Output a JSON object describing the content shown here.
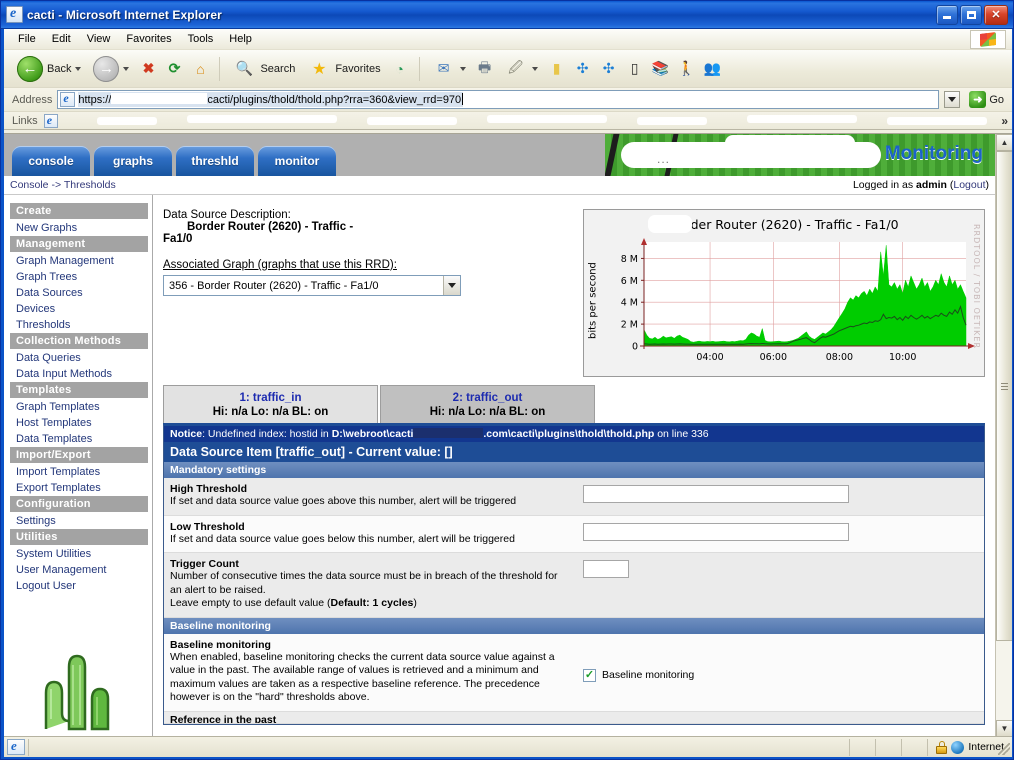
{
  "window": {
    "title": "cacti - Microsoft Internet Explorer",
    "icon": "ie-document-icon",
    "minimize": "Minimize",
    "maximize": "Restore",
    "close": "Close"
  },
  "menubar": {
    "items": [
      {
        "label": "File"
      },
      {
        "label": "Edit"
      },
      {
        "label": "View"
      },
      {
        "label": "Favorites"
      },
      {
        "label": "Tools"
      },
      {
        "label": "Help"
      }
    ],
    "logo": "windows-flag-icon"
  },
  "toolbar": {
    "back": "Back",
    "search": "Search",
    "favorites": "Favorites",
    "icons": [
      "back-icon",
      "back-dropdown-icon",
      "forward-icon",
      "forward-dropdown-icon",
      "stop-icon",
      "refresh-icon",
      "home-icon",
      "search-icon",
      "favorites-icon",
      "history-icon",
      "mail-icon",
      "mail-dropdown-icon",
      "print-icon",
      "edit-icon",
      "edit-dropdown-icon",
      "notes-icon",
      "messenger-sync-icon",
      "messenger-sync2-icon",
      "pda-icon",
      "research-icon",
      "person-icon",
      "messenger-icon"
    ]
  },
  "address": {
    "label": "Address",
    "url_prefix": "https://",
    "url_suffix": "cacti/plugins/thold/thold.php?rra=360&view_rrd=970",
    "go": "Go"
  },
  "links": {
    "label": "Links",
    "overflow": "»"
  },
  "cacti": {
    "tabs": [
      {
        "label": "console",
        "name": "tab-console"
      },
      {
        "label": "graphs",
        "name": "tab-graphs"
      },
      {
        "label": "threshld",
        "name": "tab-threshld"
      },
      {
        "label": "monitor",
        "name": "tab-monitor"
      }
    ],
    "banner_title": "Monitoring",
    "breadcrumb_console": "Console",
    "breadcrumb_sep": " -> ",
    "breadcrumb_page": "Thresholds",
    "logged_in_prefix": "Logged in as ",
    "logged_in_user": "admin",
    "logout_open": " (",
    "logout": "Logout",
    "logout_close": ")"
  },
  "sidebar": {
    "groups": [
      {
        "header": "Create",
        "items": [
          {
            "label": "New Graphs",
            "name": "sidebar-item-new-graphs"
          }
        ]
      },
      {
        "header": "Management",
        "items": [
          {
            "label": "Graph Management",
            "name": "sidebar-item-graph-management"
          },
          {
            "label": "Graph Trees",
            "name": "sidebar-item-graph-trees"
          },
          {
            "label": "Data Sources",
            "name": "sidebar-item-data-sources"
          },
          {
            "label": "Devices",
            "name": "sidebar-item-devices"
          },
          {
            "label": "Thresholds",
            "name": "sidebar-item-thresholds"
          }
        ]
      },
      {
        "header": "Collection Methods",
        "items": [
          {
            "label": "Data Queries",
            "name": "sidebar-item-data-queries"
          },
          {
            "label": "Data Input Methods",
            "name": "sidebar-item-data-input-methods"
          }
        ]
      },
      {
        "header": "Templates",
        "items": [
          {
            "label": "Graph Templates",
            "name": "sidebar-item-graph-templates"
          },
          {
            "label": "Host Templates",
            "name": "sidebar-item-host-templates"
          },
          {
            "label": "Data Templates",
            "name": "sidebar-item-data-templates"
          }
        ]
      },
      {
        "header": "Import/Export",
        "items": [
          {
            "label": "Import Templates",
            "name": "sidebar-item-import-templates"
          },
          {
            "label": "Export Templates",
            "name": "sidebar-item-export-templates"
          }
        ]
      },
      {
        "header": "Configuration",
        "items": [
          {
            "label": "Settings",
            "name": "sidebar-item-settings"
          }
        ]
      },
      {
        "header": "Utilities",
        "items": [
          {
            "label": "System Utilities",
            "name": "sidebar-item-system-utilities"
          },
          {
            "label": "User Management",
            "name": "sidebar-item-user-management"
          },
          {
            "label": "Logout User",
            "name": "sidebar-item-logout-user"
          }
        ]
      }
    ],
    "logo": "cactus-logo"
  },
  "main": {
    "desc_label": "Data Source Description:",
    "desc_line1": "Border Router (2620) - Traffic -",
    "desc_line2": "Fa1/0",
    "assoc_label": "Associated Graph (graphs that use this RRD):",
    "assoc_selected": "356 -       Border Router (2620) - Traffic - Fa1/0",
    "ds_tabs": [
      {
        "title": "1: traffic_in",
        "sub": "Hi: n/a Lo: n/a BL: on",
        "active": false
      },
      {
        "title": "2: traffic_out",
        "sub": "Hi: n/a Lo: n/a BL: on",
        "active": true
      }
    ],
    "notice_prefix": "Notice",
    "notice_colon": ": Undefined index: hostid in ",
    "notice_path1": "D:\\webroot\\cacti",
    "notice_path2": ".com\\cacti\\plugins\\thold\\thold.php",
    "notice_line": " on line 336",
    "ds_item_bar": "Data Source Item [traffic_out] - Current value: []",
    "section_mandatory": "Mandatory settings",
    "section_baseline": "Baseline monitoring",
    "rows": [
      {
        "title": "High Threshold",
        "desc": "If set and data source value goes above this number, alert will be triggered",
        "value": "",
        "field": "high-threshold-input"
      },
      {
        "title": "Low Threshold",
        "desc": "If set and data source value goes below this number, alert will be triggered",
        "value": "",
        "field": "low-threshold-input"
      },
      {
        "title": "Trigger Count",
        "desc_a": "Number of consecutive times the data source must be in breach of the threshold for an alert to be raised.",
        "desc_b": "Leave empty to use default value (",
        "desc_bold": "Default: 1 cycles",
        "desc_c": ")",
        "value": "",
        "field": "trigger-count-input"
      }
    ],
    "baseline": {
      "title": "Baseline monitoring",
      "desc": "When enabled, baseline monitoring checks the current data source value against a value in the past. The available range of values is retrieved and a minimum and maximum values are taken as a respective baseline reference. The precedence however is on the \"hard\" thresholds above.",
      "checkbox_label": "Baseline monitoring",
      "checked": true,
      "check_mark": "✓"
    },
    "cutoff_row": "Reference in the past"
  },
  "chart_data": {
    "type": "area",
    "title": "Border Router (2620) - Traffic - Fa1/0",
    "ylabel": "bits per second",
    "xlabel": "",
    "watermark": "RRDTOOL / TOBI OETIKER",
    "ylim": [
      0,
      9500000
    ],
    "ytick_labels": [
      "0",
      "2 M",
      "4 M",
      "6 M",
      "8 M"
    ],
    "ytick_values": [
      0,
      2000000,
      4000000,
      6000000,
      8000000
    ],
    "xtick_labels": [
      "04:00",
      "06:00",
      "08:00",
      "10:00"
    ],
    "grid": true,
    "legend_position": "none",
    "series": [
      {
        "name": "traffic_in",
        "type": "area",
        "color": "#00cc00",
        "values": [
          1500000,
          1000000,
          700000,
          650000,
          800000,
          600000,
          700000,
          900000,
          750000,
          800000,
          850000,
          700000,
          900000,
          1000000,
          800000,
          700000,
          600000,
          400000,
          350000,
          400000,
          450000,
          400000,
          380000,
          420000,
          400000,
          430000,
          380000,
          400000,
          420000,
          450000,
          400000,
          380000,
          420000,
          400000,
          450000,
          500000,
          480000,
          600000,
          1000000,
          1200000,
          1100000,
          900000,
          800000,
          1600000,
          500000,
          400000,
          380000,
          400000,
          420000,
          450000,
          400000,
          380000,
          400000,
          450000,
          500000,
          600000,
          700000,
          900000,
          1100000,
          1300000,
          900000,
          700000,
          600000,
          800000,
          1000000,
          1200000,
          1100000,
          1300000,
          1500000,
          1800000,
          2200000,
          2600000,
          3000000,
          3400000,
          4000000,
          4400000,
          4200000,
          4600000,
          4400000,
          4800000,
          5000000,
          4600000,
          5200000,
          4800000,
          5400000,
          5000000,
          8600000,
          6400000,
          9200000,
          5600000,
          5400000,
          5800000,
          5200000,
          5600000,
          4800000,
          6000000,
          5400000,
          6400000,
          5800000,
          5200000,
          5600000,
          6200000,
          5400000,
          5800000,
          5000000,
          5400000,
          6000000,
          5600000,
          6600000,
          5800000,
          5400000,
          6400000,
          5600000,
          6000000,
          5200000,
          5600000,
          5000000,
          4400000
        ]
      },
      {
        "name": "traffic_out",
        "type": "line",
        "color": "#1a4d1a",
        "values": [
          200000,
          180000,
          160000,
          170000,
          180000,
          160000,
          170000,
          180000,
          175000,
          180000,
          185000,
          170000,
          180000,
          190000,
          180000,
          175000,
          170000,
          160000,
          155000,
          160000,
          165000,
          160000,
          158000,
          162000,
          160000,
          163000,
          158000,
          160000,
          162000,
          165000,
          160000,
          158000,
          162000,
          160000,
          165000,
          170000,
          168000,
          180000,
          200000,
          220000,
          210000,
          200000,
          195000,
          230000,
          200000,
          190000,
          185000,
          190000,
          195000,
          200000,
          195000,
          190000,
          200000,
          300000,
          420000,
          500000,
          560000,
          620000,
          700000,
          760000,
          600000,
          400000,
          300000,
          500000,
          700000,
          850000,
          800000,
          900000,
          1000000,
          1100000,
          1250000,
          1400000,
          1500000,
          1600000,
          1700000,
          1800000,
          1750000,
          1850000,
          1900000,
          2000000,
          2100000,
          2050000,
          2200000,
          2150000,
          2300000,
          2250000,
          2400000,
          2900000,
          2500000,
          2600000,
          2550000,
          2700000,
          2400000,
          2600000,
          2350000,
          2700000,
          2500000,
          2800000,
          2600000,
          2450000,
          2600000,
          2800000,
          2550000,
          2700000,
          2500000,
          2650000,
          2800000,
          2700000,
          3000000,
          2800000,
          2700000,
          3100000,
          2900000,
          3300000,
          3000000,
          3600000,
          2600000,
          1900000
        ]
      }
    ]
  },
  "statusbar": {
    "zone": "Internet",
    "lock": "lock-icon",
    "globe": "globe-icon"
  }
}
